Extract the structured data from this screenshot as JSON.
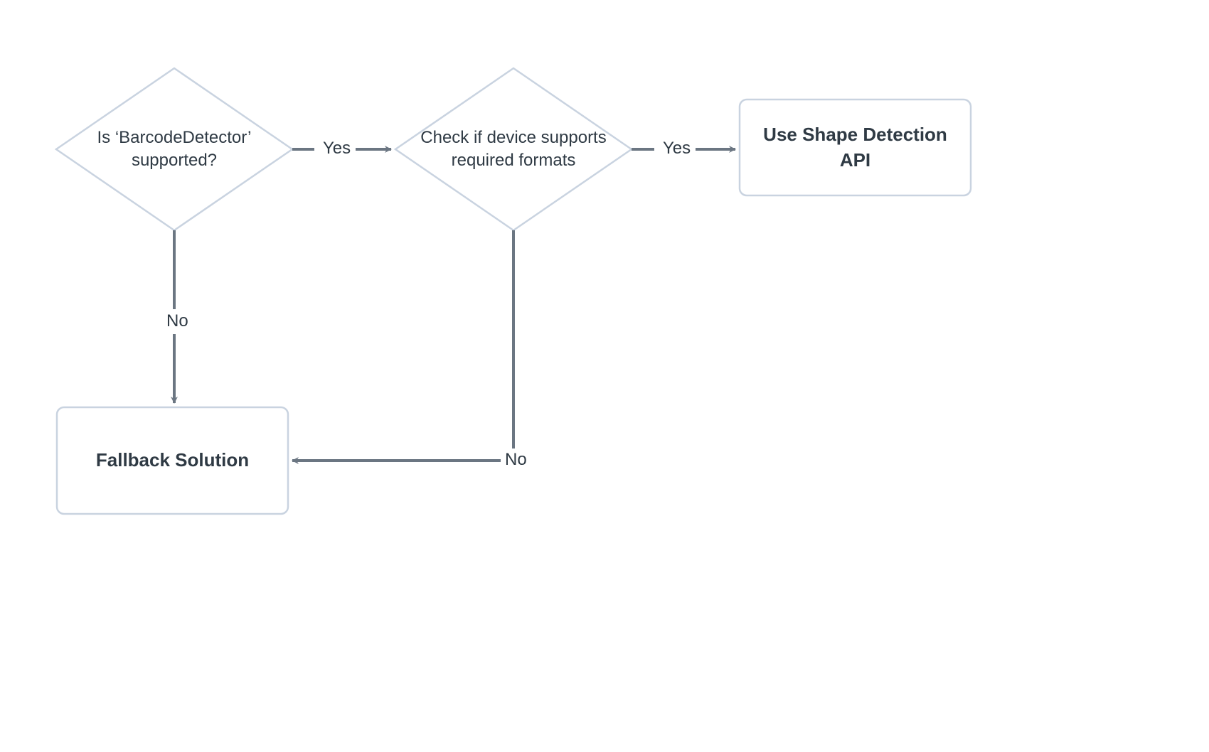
{
  "diagram": {
    "nodes": {
      "decision1": {
        "line1": "Is ‘BarcodeDetector’",
        "line2": "supported?"
      },
      "decision2": {
        "line1": "Check if device supports",
        "line2": "required formats"
      },
      "result_api": {
        "line1": "Use Shape Detection",
        "line2": "API"
      },
      "result_fallback": {
        "line1": "Fallback Solution"
      }
    },
    "edges": {
      "d1_yes": "Yes",
      "d1_no": "No",
      "d2_yes": "Yes",
      "d2_no": "No"
    },
    "style": {
      "stroke_shape": "#c9d3e0",
      "stroke_arrow": "#6b7682",
      "fill_bg": "#ffffff"
    }
  }
}
